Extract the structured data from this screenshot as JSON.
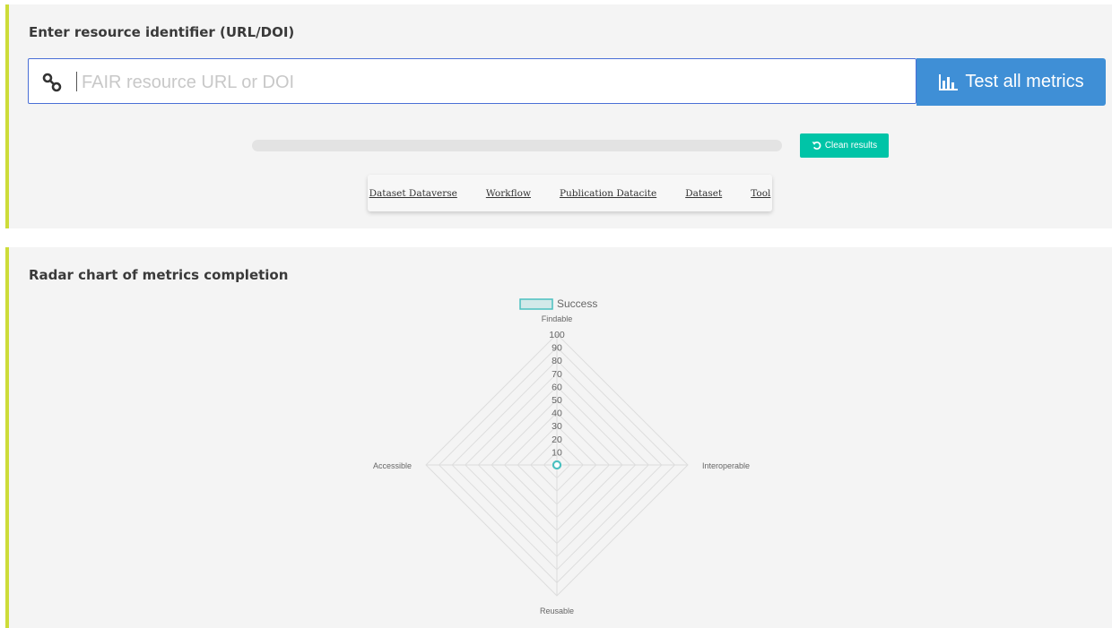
{
  "input_section": {
    "title": "Enter resource identifier (URL/DOI)",
    "url_placeholder": "FAIR resource URL or DOI",
    "url_value": "",
    "test_button_label": "Test all metrics",
    "progress_fraction": 0,
    "clean_button_label": "Clean results",
    "examples": [
      "Dataset Dataverse",
      "Workflow",
      "Publication Datacite",
      "Dataset",
      "Tool"
    ]
  },
  "chart_section": {
    "title": "Radar chart of metrics completion"
  },
  "icons": {
    "url": "link-icon",
    "test_button": "bar-chart-icon",
    "clean_button": "undo-icon"
  },
  "colors": {
    "accent_border": "#cddc39",
    "primary_button": "#3f8fd6",
    "clean_button": "#00c4a7",
    "series_color": "#4bc0c0"
  },
  "chart_data": {
    "type": "radar",
    "title": "",
    "axes": [
      "Findable",
      "Interoperable",
      "Reusable",
      "Accessible"
    ],
    "scale": {
      "min": 0,
      "max": 100,
      "step": 10
    },
    "tick_labels": [
      "10",
      "20",
      "30",
      "40",
      "50",
      "60",
      "70",
      "80",
      "90",
      "100"
    ],
    "legend_position": "top",
    "series": [
      {
        "name": "Success",
        "values": [
          0,
          0,
          0,
          0
        ]
      }
    ]
  }
}
